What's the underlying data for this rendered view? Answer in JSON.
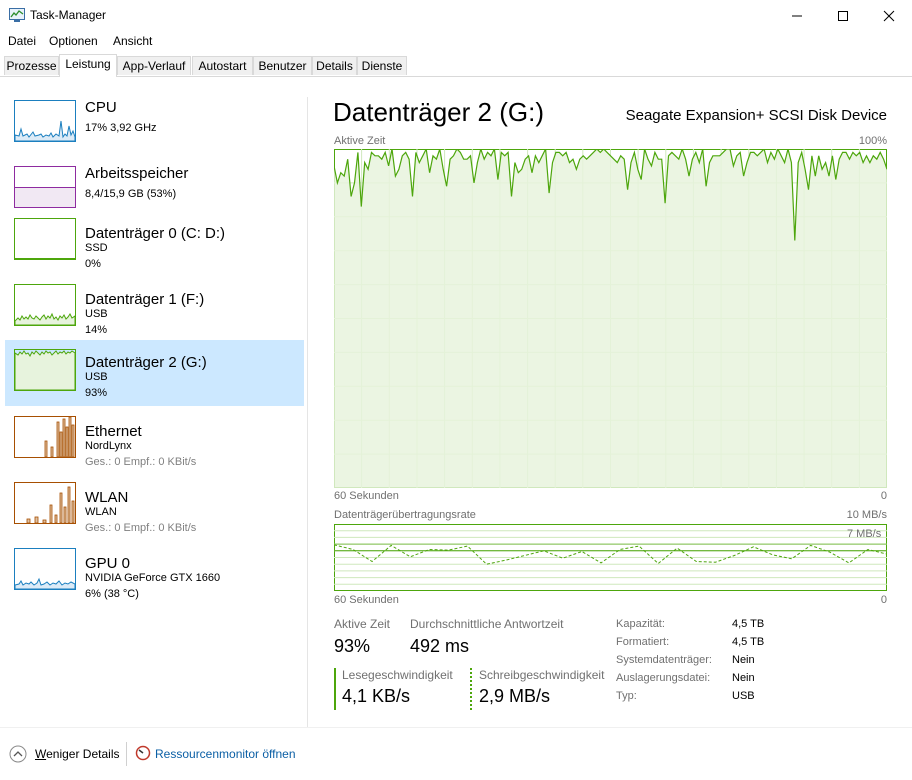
{
  "window": {
    "title": "Task-Manager"
  },
  "menu": [
    "Datei",
    "Optionen",
    "Ansicht"
  ],
  "tabs": [
    "Prozesse",
    "Leistung",
    "App-Verlauf",
    "Autostart",
    "Benutzer",
    "Details",
    "Dienste"
  ],
  "sidebar": {
    "items": [
      {
        "title": "CPU",
        "lines": [
          "17% 3,92 GHz"
        ],
        "color": "#1b7fbf"
      },
      {
        "title": "Arbeitsspeicher",
        "lines": [
          "8,4/15,9 GB (53%)"
        ],
        "color": "#8e2ba0",
        "level": 0.53
      },
      {
        "title": "Datenträger 0 (C: D:)",
        "lines": [
          "SSD",
          "0%"
        ],
        "color": "#4da60c"
      },
      {
        "title": "Datenträger 1 (F:)",
        "lines": [
          "USB",
          "14%"
        ],
        "color": "#4da60c"
      },
      {
        "title": "Datenträger 2 (G:)",
        "lines": [
          "USB",
          "93%"
        ],
        "color": "#4da60c",
        "selected": true
      },
      {
        "title": "Ethernet",
        "lines": [
          "NordLynx",
          "Ges.: 0 Empf.: 0 KBit/s"
        ],
        "color": "#a74f01"
      },
      {
        "title": "WLAN",
        "lines": [
          "WLAN",
          "Ges.: 0 Empf.: 0 KBit/s"
        ],
        "color": "#a74f01"
      },
      {
        "title": "GPU 0",
        "lines": [
          "NVIDIA GeForce GTX 1660",
          "6% (38 °C)"
        ],
        "color": "#1b7fbf"
      }
    ]
  },
  "main": {
    "title": "Datenträger 2 (G:)",
    "device": "Seagate Expansion+ SCSI Disk Device",
    "chart1": {
      "label": "Aktive Zeit",
      "max": "100%",
      "time": "60 Sekunden",
      "zero": "0"
    },
    "chart2": {
      "label": "Datenträgerübertragungsrate",
      "max": "10 MB/s",
      "mark": "7 MB/s",
      "time": "60 Sekunden",
      "zero": "0"
    },
    "stats": {
      "active_label": "Aktive Zeit",
      "active_value": "93%",
      "resp_label": "Durchschnittliche Antwortzeit",
      "resp_value": "492 ms",
      "read_label": "Lesegeschwindigkeit",
      "read_value": "4,1 KB/s",
      "write_label": "Schreibgeschwindigkeit",
      "write_value": "2,9 MB/s"
    },
    "props": [
      {
        "k": "Kapazität:",
        "v": "4,5 TB"
      },
      {
        "k": "Formatiert:",
        "v": "4,5 TB"
      },
      {
        "k": "Systemdatenträger:",
        "v": "Nein"
      },
      {
        "k": "Auslagerungsdatei:",
        "v": "Nein"
      },
      {
        "k": "Typ:",
        "v": "USB"
      }
    ]
  },
  "chart_data": [
    {
      "type": "line",
      "title": "Aktive Zeit",
      "xlabel": "60 Sekunden",
      "ylim": [
        0,
        100
      ],
      "series": [
        {
          "values": [
            95,
            90,
            93,
            92,
            97,
            86,
            90,
            99,
            83,
            96,
            94,
            99,
            98,
            98,
            97,
            99,
            95,
            100,
            92,
            94,
            98,
            99,
            97,
            86,
            99,
            96,
            98,
            100,
            93,
            98,
            97,
            100,
            94,
            89,
            97,
            98,
            100,
            99,
            97,
            97,
            98,
            90,
            96,
            100,
            97,
            99,
            98,
            100,
            91,
            99,
            98,
            99,
            86,
            96,
            93,
            94,
            97,
            98,
            93,
            98,
            96,
            98,
            100,
            87,
            96,
            99,
            99,
            98,
            99,
            96,
            97,
            94,
            97,
            98,
            97,
            98,
            99,
            100,
            99,
            100,
            99,
            98,
            97,
            96,
            98,
            97,
            88,
            96,
            99,
            94,
            91,
            100,
            97,
            95,
            99,
            97,
            97,
            84,
            98,
            99,
            98,
            97,
            100,
            97,
            92,
            97,
            99,
            96,
            100,
            89,
            96,
            98,
            98,
            98,
            99,
            100,
            100,
            95,
            98,
            99,
            92,
            96,
            99,
            99,
            98,
            99,
            100,
            96,
            99,
            97,
            100,
            98,
            96,
            100,
            96,
            73,
            96,
            99,
            94,
            88,
            98,
            92,
            98,
            94,
            96,
            92,
            98,
            91,
            97,
            99,
            99,
            97,
            99,
            98,
            99,
            96,
            98,
            96,
            98,
            97,
            99,
            97,
            94
          ]
        }
      ]
    },
    {
      "type": "line",
      "title": "Datenträgerübertragungsrate",
      "xlabel": "60 Sekunden",
      "ylim": [
        0,
        10
      ],
      "series": [
        {
          "name": "Lesen",
          "values": [
            6,
            6,
            6,
            6,
            6,
            6,
            6,
            6,
            6,
            6,
            6,
            6,
            6,
            6,
            6,
            6,
            6,
            6,
            6,
            6,
            6,
            6,
            6,
            6,
            6,
            6,
            6,
            6,
            6,
            6
          ]
        },
        {
          "name": "Schreiben",
          "values": [
            6.9,
            6.2,
            4.4,
            6.8,
            5.1,
            6.2,
            6.1,
            6.7,
            4.0,
            4.6,
            5.3,
            6.0,
            4.9,
            5.9,
            4.2,
            6.2,
            6.7,
            4.1,
            6.4,
            4.4,
            4.3,
            5.3,
            6.6,
            5.4,
            4.8,
            6.8,
            5.8,
            4.2,
            6.2,
            5.5
          ]
        }
      ]
    }
  ]
}
